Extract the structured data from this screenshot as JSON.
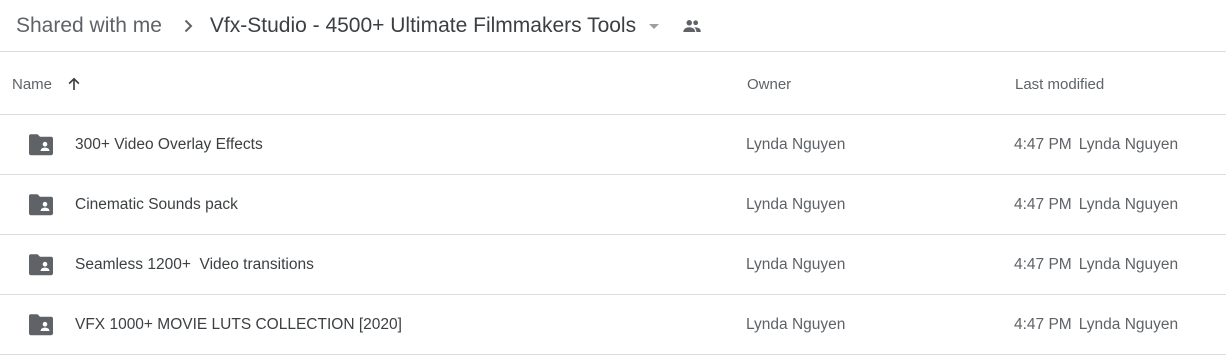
{
  "breadcrumb": {
    "root": "Shared with me",
    "current": "Vfx-Studio - 4500+ Ultimate Filmmakers Tools",
    "separator_icon": "chevron-right-icon",
    "dropdown_icon": "arrow-drop-down-icon",
    "shared_icon": "people-icon"
  },
  "columns": {
    "name": "Name",
    "owner": "Owner",
    "last_modified": "Last modified",
    "sort_icon": "arrow-upward-icon"
  },
  "rows": [
    {
      "name": "300+ Video Overlay Effects",
      "owner": "Lynda Nguyen",
      "modified_time": "4:47 PM",
      "modified_by": "Lynda Nguyen",
      "icon": "shared-folder-icon"
    },
    {
      "name": "Cinematic Sounds pack",
      "owner": "Lynda Nguyen",
      "modified_time": "4:47 PM",
      "modified_by": "Lynda Nguyen",
      "icon": "shared-folder-icon"
    },
    {
      "name": "Seamless 1200+  Video transitions",
      "owner": "Lynda Nguyen",
      "modified_time": "4:47 PM",
      "modified_by": "Lynda Nguyen",
      "icon": "shared-folder-icon"
    },
    {
      "name": "VFX 1000+ MOVIE LUTS COLLECTION [2020]",
      "owner": "Lynda Nguyen",
      "modified_time": "4:47 PM",
      "modified_by": "Lynda Nguyen",
      "icon": "shared-folder-icon"
    }
  ],
  "colors": {
    "icon_gray": "#5f6368",
    "text_dark": "#3c4043",
    "divider": "#dadce0"
  }
}
